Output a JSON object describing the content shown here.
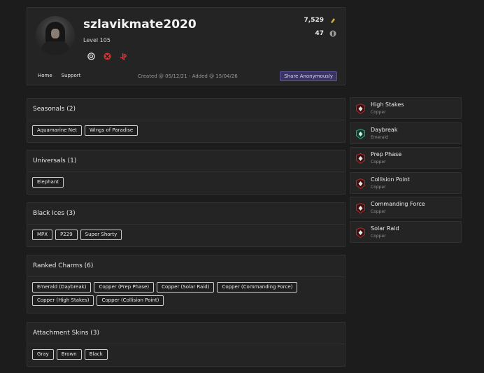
{
  "profile": {
    "username": "szlavikmate2020",
    "level": "Level 105",
    "stats": {
      "renown": "7,529",
      "credits": "47"
    },
    "platforms": [
      "ubisoft-icon",
      "xbox-icon",
      "playstation-icon"
    ],
    "nav": [
      "Home",
      "Support"
    ],
    "created_text": "Created @ 05/12/21 - Added @ 15/04/26",
    "share_label": "Share Anonymously"
  },
  "sections": [
    {
      "title": "Seasonals (2)",
      "items": [
        "Aquamarine Net",
        "Wings of Paradise"
      ]
    },
    {
      "title": "Universals (1)",
      "items": [
        "Elephant"
      ]
    },
    {
      "title": "Black Ices (3)",
      "items": [
        "MPX",
        "P229",
        "Super Shorty"
      ]
    },
    {
      "title": "Ranked Charms (6)",
      "items": [
        "Emerald (Daybreak)",
        "Copper (Prep Phase)",
        "Copper (Solar Raid)",
        "Copper (Commanding Force)",
        "Copper (High Stakes)",
        "Copper (Collision Point)"
      ]
    },
    {
      "title": "Attachment Skins (3)",
      "items": [
        "Gray",
        "Brown",
        "Black"
      ]
    }
  ],
  "ranks": [
    {
      "name": "High Stakes",
      "tier": "Copper"
    },
    {
      "name": "Daybreak",
      "tier": "Emerald"
    },
    {
      "name": "Prep Phase",
      "tier": "Copper"
    },
    {
      "name": "Collision Point",
      "tier": "Copper"
    },
    {
      "name": "Commanding Force",
      "tier": "Copper"
    },
    {
      "name": "Solar Raid",
      "tier": "Copper"
    }
  ],
  "colors": {
    "background": "#1c1c1c",
    "card": "#242424",
    "share_button": "#3a3560",
    "copper": "#b02a2a",
    "emerald": "#2aa877",
    "renown_icon": "#d4b23a",
    "xbox": "#e03030",
    "playstation": "#e03030"
  }
}
